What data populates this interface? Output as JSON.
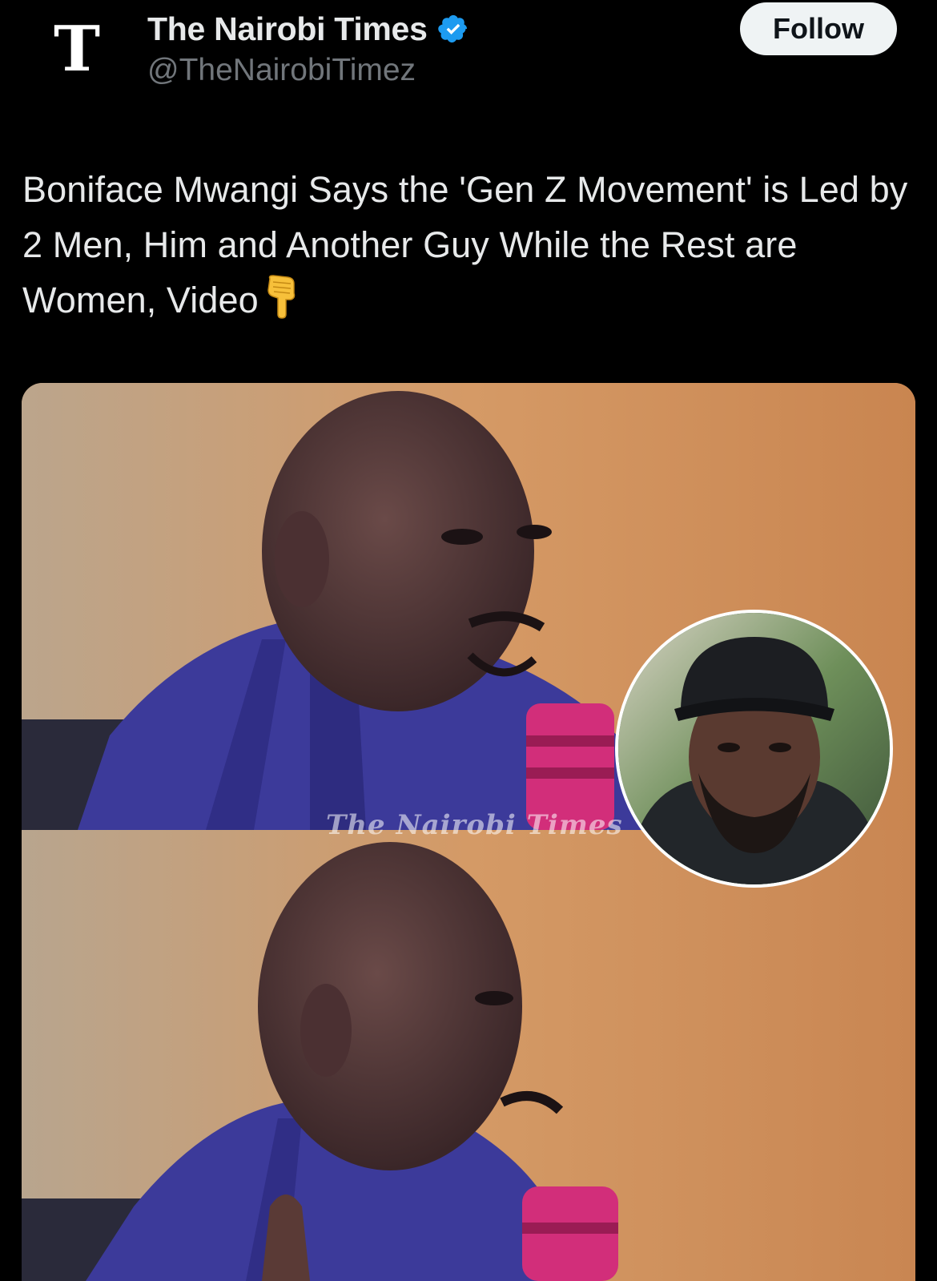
{
  "post": {
    "account_name": "The Nairobi Times",
    "handle": "@TheNairobiTimez",
    "follow_label": "Follow",
    "text": "Boniface Mwangi Says the 'Gen Z Movement' is Led by 2 Men, Him and Another Guy While the Rest are Women, Video",
    "logo_glyph": "T"
  },
  "media": {
    "watermark": "The Nairobi Times"
  },
  "icons": {
    "logo": "newspaper-logo-icon",
    "verified": "verified-badge-icon",
    "pointing_down": "backhand-index-pointing-down-emoji"
  },
  "colors": {
    "background": "#000000",
    "text_primary": "#e7e9ea",
    "text_secondary": "#71767b",
    "verified_blue": "#1d9bf0",
    "follow_button_bg": "#eff3f4",
    "follow_button_text": "#0f1419"
  }
}
